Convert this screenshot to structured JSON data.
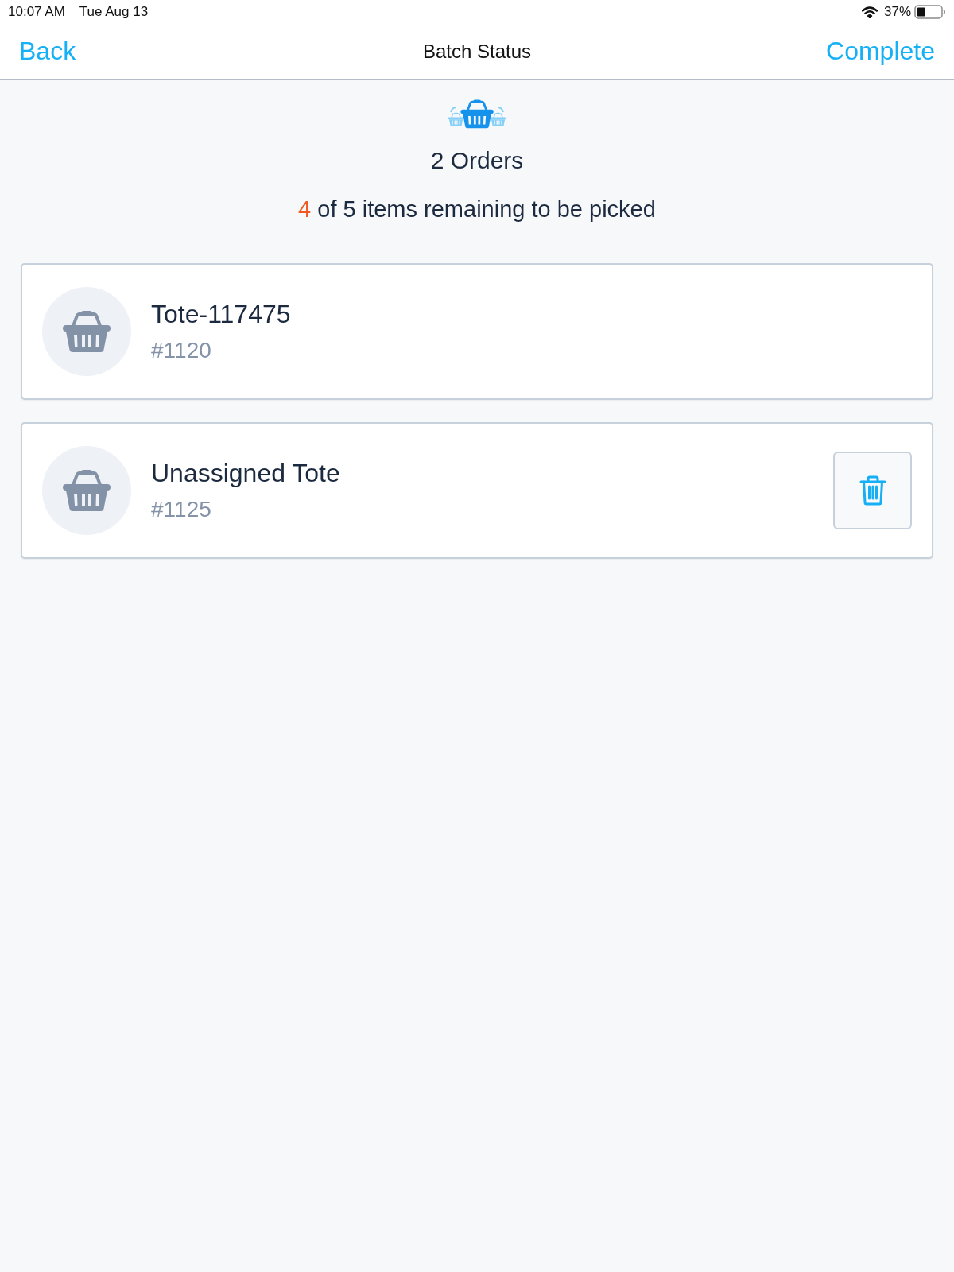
{
  "status_bar": {
    "time": "10:07 AM",
    "date": "Tue Aug 13",
    "battery": "37%"
  },
  "nav": {
    "back": "Back",
    "title": "Batch Status",
    "action": "Complete"
  },
  "summary": {
    "orders": "2 Orders",
    "remaining_count": "4",
    "remaining_text": "of 5 items remaining to be picked"
  },
  "totes": [
    {
      "name": "Tote-117475",
      "order": "#1120",
      "deletable": false
    },
    {
      "name": "Unassigned Tote",
      "order": "#1125",
      "deletable": true
    }
  ]
}
